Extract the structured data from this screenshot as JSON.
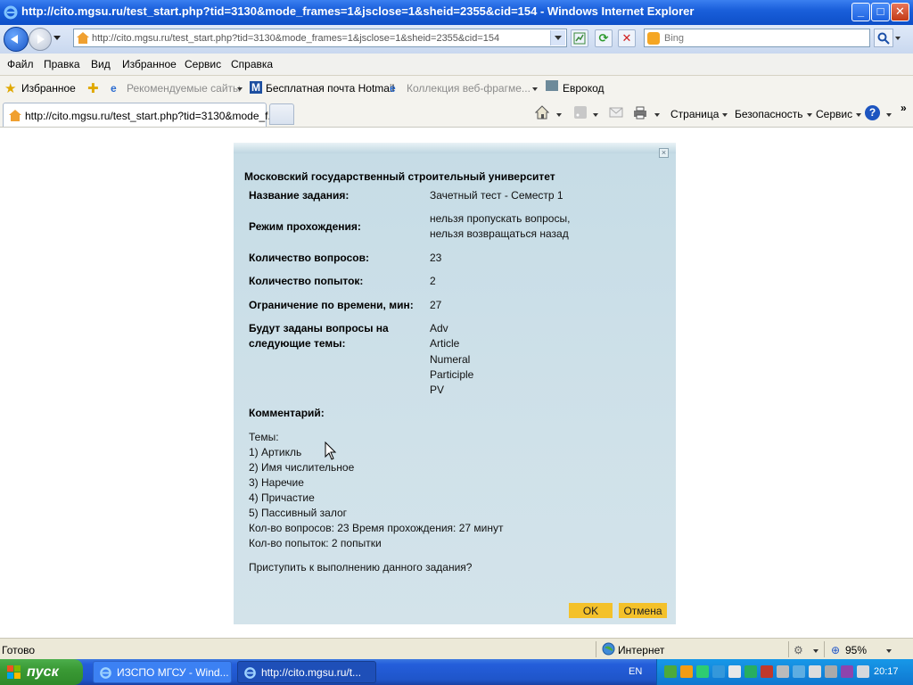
{
  "window": {
    "title": "http://cito.mgsu.ru/test_start.php?tid=3130&mode_frames=1&jsclose=1&sheid=2355&cid=154 - Windows Internet Explorer",
    "minimize_label": "_",
    "maximize_label": "□",
    "close_label": "✕"
  },
  "address_bar": {
    "url": "http://cito.mgsu.ru/test_start.php?tid=3130&mode_frames=1&jsclose=1&sheid=2355&cid=154"
  },
  "search": {
    "placeholder": "Bing"
  },
  "menu": [
    "Файл",
    "Правка",
    "Вид",
    "Избранное",
    "Сервис",
    "Справка"
  ],
  "favorites_bar": {
    "favorites_label": "Избранное",
    "recommended_sites": "Рекомендуемые сайты",
    "hotmail": "Бесплатная почта Hotmail",
    "web_slices": "Коллекция веб-фрагме...",
    "evrokod": "Еврокод"
  },
  "tab": {
    "title": "http://cito.mgsu.ru/test_start.php?tid=3130&mode_f..."
  },
  "command_bar": {
    "page": "Страница",
    "safety": "Безопасность",
    "tools": "Сервис",
    "help_icon": "?"
  },
  "dialog": {
    "close_label": "×",
    "university": "Московский государственный строительный университет",
    "rows": [
      {
        "label": "Название задания:",
        "value": "Зачетный тест - Семестр 1"
      },
      {
        "label": "Режим прохождения:",
        "value_lines": [
          "нельзя пропускать вопросы,",
          "нельзя возвращаться назад"
        ]
      },
      {
        "label": "Количество вопросов:",
        "value": "23"
      },
      {
        "label": "Количество попыток:",
        "value": "2"
      },
      {
        "label": "Ограничение по времени, мин:",
        "value": "27"
      },
      {
        "label_lines": [
          "Будут заданы вопросы на",
          "следующие темы:"
        ],
        "value_lines": [
          "Adv",
          "Article",
          "Numeral",
          "Participle",
          "PV"
        ]
      }
    ],
    "comment_label": "Комментарий:",
    "comment_lines": [
      "Темы:",
      "1) Артикль",
      "2) Имя числительное",
      "3) Наречие",
      "4) Причастие",
      "5) Пассивный залог",
      "Кол-во вопросов: 23 Время прохождения: 27 минут",
      "Кол-во попыток: 2 попытки"
    ],
    "question": "Приступить к выполнению данного задания?",
    "ok_label": "OK",
    "cancel_label": "Отмена"
  },
  "status_bar": {
    "status": "Готово",
    "zone": "Интернет",
    "zoom": "95%"
  },
  "taskbar": {
    "start_label": "пуск",
    "items": [
      "ИЗСПО МГСУ - Wind...",
      "http://cito.mgsu.ru/t..."
    ],
    "language": "EN",
    "clock": "20:17"
  },
  "colors": {
    "titlebar": "#1a5fdb",
    "dialog_bg": "#cfe1e9",
    "button_accent": "#f4c12a",
    "start_green": "#3a9a35"
  }
}
